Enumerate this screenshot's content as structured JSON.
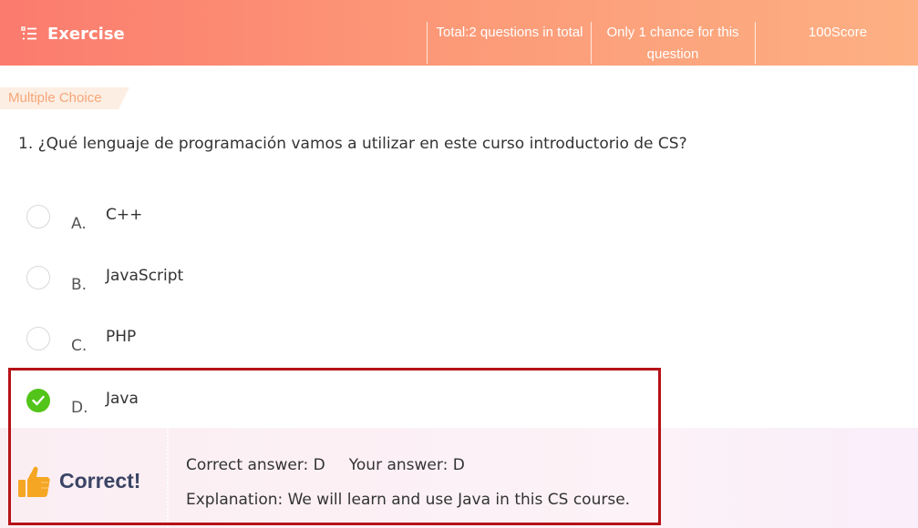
{
  "header": {
    "title": "Exercise",
    "total": "Total:2 questions in total",
    "chance": "Only 1 chance for this question",
    "score": "100Score"
  },
  "question_type": "Multiple Choice",
  "question": "1. ¿Qué lenguaje de programación vamos a utilizar en este curso introductorio de CS?",
  "options": [
    {
      "letter": "A.",
      "text": "C++",
      "selected": false
    },
    {
      "letter": "B.",
      "text": "JavaScript",
      "selected": false
    },
    {
      "letter": "C.",
      "text": "PHP",
      "selected": false
    },
    {
      "letter": "D.",
      "text": "Java",
      "selected": true
    }
  ],
  "feedback": {
    "result": "Correct!",
    "correct_answer": "Correct answer: D",
    "your_answer": "Your answer: D",
    "explanation": "Explanation: We will learn and use Java in this CS course."
  },
  "colors": {
    "header_start": "#fb7b6e",
    "header_end": "#fdb083",
    "correct_green": "#52c41a",
    "highlight_red": "#b51218",
    "thumb": "#f5a623"
  },
  "icons": {
    "header": "list-icon",
    "selected": "check-circle-icon",
    "result": "thumbs-up-icon"
  }
}
